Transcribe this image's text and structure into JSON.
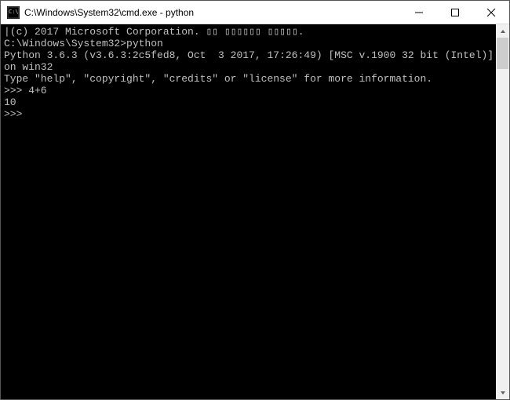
{
  "window": {
    "title": "C:\\Windows\\System32\\cmd.exe - python"
  },
  "terminal": {
    "lines": [
      "|(c) 2017 Microsoft Corporation. ▯▯ ▯▯▯▯▯▯ ▯▯▯▯▯.",
      "",
      "C:\\Windows\\System32>python",
      "Python 3.6.3 (v3.6.3:2c5fed8, Oct  3 2017, 17:26:49) [MSC v.1900 32 bit (Intel)] on win32",
      "Type \"help\", \"copyright\", \"credits\" or \"license\" for more information.",
      ">>> 4+6",
      "10",
      ">>>"
    ]
  }
}
